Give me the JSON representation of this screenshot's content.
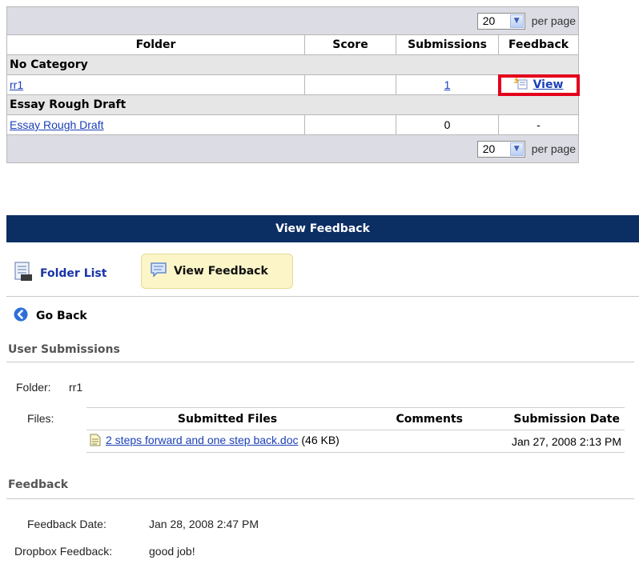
{
  "pager": {
    "value": "20",
    "label": "per page"
  },
  "table": {
    "headers": [
      "Folder",
      "Score",
      "Submissions",
      "Feedback"
    ],
    "categories": [
      {
        "name": "No Category",
        "row": {
          "folder": "rr1",
          "score": "",
          "submissions": "1",
          "feedback": "View"
        }
      },
      {
        "name": "Essay Rough Draft",
        "row": {
          "folder": "Essay Rough Draft",
          "score": "",
          "submissions": "0",
          "feedback": "-"
        }
      }
    ]
  },
  "banner": {
    "title": "View Feedback"
  },
  "toolbar": {
    "folder_list": "Folder List",
    "view_feedback": "View Feedback"
  },
  "go_back": "Go Back",
  "user_submissions": {
    "title": "User Submissions",
    "folder_label": "Folder:",
    "folder_value": "rr1",
    "files_label": "Files:",
    "columns": [
      "Submitted Files",
      "Comments",
      "Submission Date"
    ],
    "file": {
      "name": "2 steps forward and one step back.doc",
      "size": "(46 KB)",
      "date": "Jan 27, 2008 2:13 PM"
    }
  },
  "feedback": {
    "title": "Feedback",
    "date_label": "Feedback Date:",
    "date_value": "Jan 28, 2008 2:47 PM",
    "dropbox_label": "Dropbox Feedback:",
    "dropbox_value": "good job!"
  },
  "colors": {
    "banner": "#0b2e63",
    "highlight": "#e3001b",
    "link": "#1a3fb8",
    "active_tab": "#fbf5c8"
  }
}
